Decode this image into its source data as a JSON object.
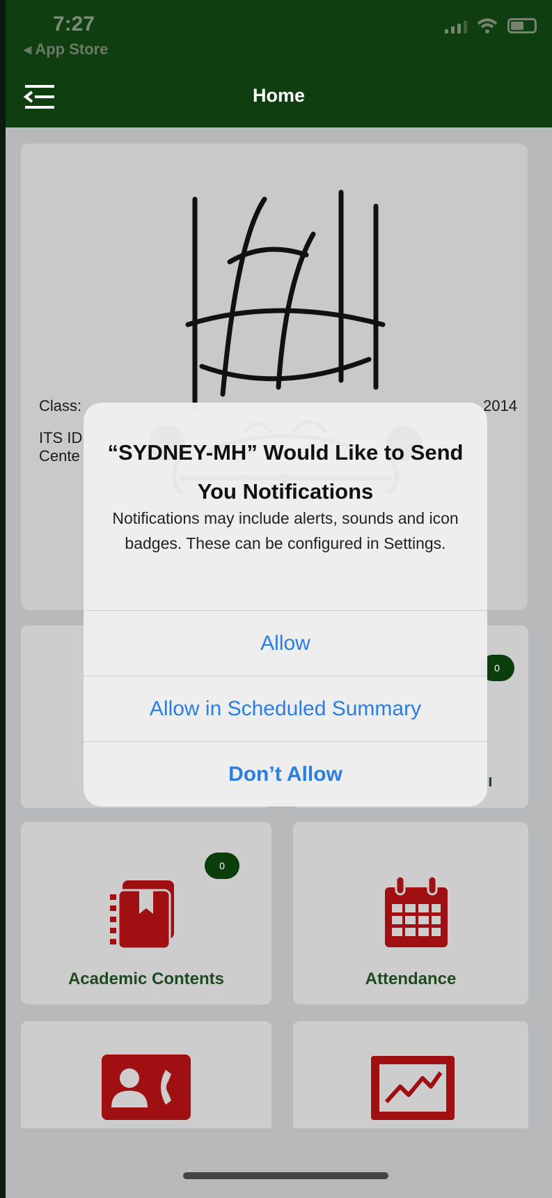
{
  "status": {
    "time": "7:27",
    "back_app": "◂ App Store"
  },
  "header": {
    "title": "Home"
  },
  "profile": {
    "class_label": "Class:",
    "year_tail": "2014",
    "its_label": "ITS ID",
    "center_label": "Cente"
  },
  "tiles": [
    {
      "label": "Academic Contents",
      "badge": "0",
      "icon": "book-bookmark-icon",
      "color": "#a00f12"
    },
    {
      "label": "Attendance",
      "icon": "calendar-icon",
      "color": "#a00f12"
    },
    {
      "label": "",
      "icon": "contact-phone-icon",
      "color": "#a00f12"
    },
    {
      "label": "",
      "icon": "chart-line-icon",
      "color": "#a00f12"
    }
  ],
  "hidden_tile": {
    "badge": "0",
    "label_tail": "ı"
  },
  "alert": {
    "title": "“SYDNEY-MH” Would Like to Send You Notifications",
    "message": "Notifications may include alerts, sounds and icon badges. These can be configured in Settings.",
    "buttons": [
      "Allow",
      "Allow in Scheduled Summary",
      "Don’t Allow"
    ]
  },
  "colors": {
    "header_green": "#0f3f10",
    "accent_red": "#a00f12",
    "ios_blue": "#2a7de1"
  }
}
